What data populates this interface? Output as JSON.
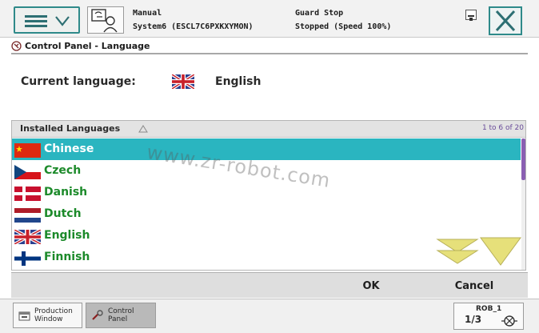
{
  "status_bar": {
    "mode": "Manual",
    "system": "System6 (ESCL7C6PXKXYMON)",
    "guard": "Guard Stop",
    "state": "Stopped (Speed 100%)",
    "menu_icon": "hamburger-menu-icon",
    "operator_icon": "operator-window-icon",
    "close_icon": "close-icon",
    "accent_color": "#2f8a8a"
  },
  "window": {
    "title": "Control Panel - Language",
    "title_icon": "control-panel-icon"
  },
  "current_language": {
    "label": "Current language:",
    "value": "English",
    "flag": "uk-flag-icon"
  },
  "language_list": {
    "header": "Installed Languages",
    "count": "1 to 6 of 20",
    "selected_index": 0,
    "selected_color": "#2ab5c0",
    "label_color": "#1c8a2a",
    "items": [
      {
        "label": "Chinese",
        "flag": "china-flag-icon"
      },
      {
        "label": "Czech",
        "flag": "czech-flag-icon"
      },
      {
        "label": "Danish",
        "flag": "denmark-flag-icon"
      },
      {
        "label": "Dutch",
        "flag": "netherlands-flag-icon"
      },
      {
        "label": "English",
        "flag": "uk-flag-icon"
      },
      {
        "label": "Finnish",
        "flag": "finland-flag-icon"
      }
    ]
  },
  "watermark": "www.zr-robot.com",
  "actions": {
    "ok": "OK",
    "cancel": "Cancel"
  },
  "taskbar": {
    "items": [
      {
        "label_line1": "Production",
        "label_line2": "Window",
        "icon": "production-window-icon"
      },
      {
        "label_line1": "Control",
        "label_line2": "Panel",
        "icon": "control-panel-icon"
      }
    ],
    "robot": {
      "name": "ROB_1",
      "fraction": "1/3",
      "icon": "robot-tool-icon"
    }
  }
}
